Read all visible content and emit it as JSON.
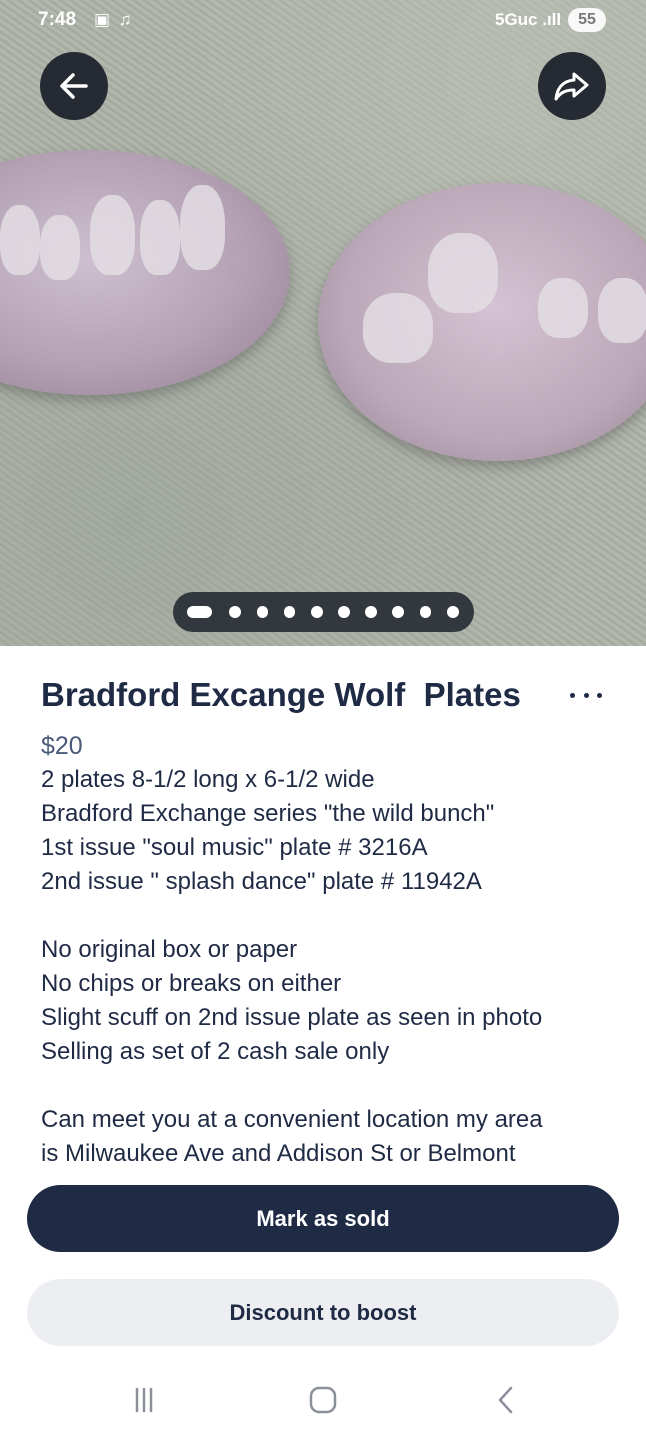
{
  "status_bar": {
    "time": "7:48",
    "notification_icons": "▣ ♫",
    "network": "5Guc .ıll",
    "battery": "55"
  },
  "photo": {
    "page_count": 10,
    "active_page": 1
  },
  "listing": {
    "title": "Bradford Excange Wolf  Plates",
    "price": "$20",
    "description_lines": [
      "2 plates 8-1/2 long x 6-1/2 wide",
      "Bradford Exchange series \"the wild bunch\"",
      "1st issue \"soul music\" plate # 3216A",
      "2nd issue \" splash dance\" plate # 11942A",
      "",
      "No original box or paper",
      "No chips or breaks on either",
      "Slight scuff on 2nd issue plate as seen in photo",
      "Selling as set of 2 cash sale only",
      "",
      "Can meet you at a convenient location my area",
      "is Milwaukee Ave and Addison St or Belmont"
    ]
  },
  "actions": {
    "mark_sold": "Mark as sold",
    "discount": "Discount to boost"
  },
  "icons": {
    "back": "arrow-left-icon",
    "share": "share-icon",
    "more": "more-horizontal-icon",
    "nav_recents": "recents-icon",
    "nav_home": "home-icon",
    "nav_back": "chevron-left-icon"
  },
  "colors": {
    "primary": "#1f2a44",
    "secondary_bg": "#eceef1",
    "price": "#4b5a78"
  }
}
